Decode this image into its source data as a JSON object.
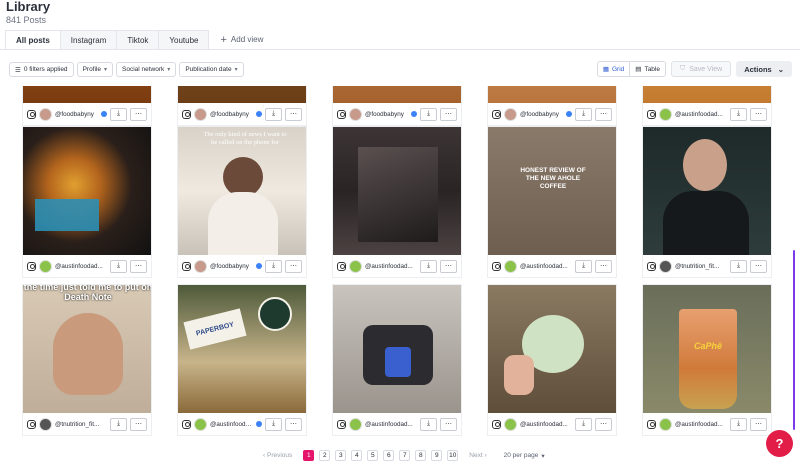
{
  "header": {
    "title": "Library",
    "subtitle": "841 Posts"
  },
  "tabs": [
    {
      "label": "All posts",
      "active": true
    },
    {
      "label": "Instagram",
      "active": false
    },
    {
      "label": "Tiktok",
      "active": false
    },
    {
      "label": "Youtube",
      "active": false
    }
  ],
  "add_view": "Add view",
  "filters": {
    "applied": "0 filters applied",
    "profile": "Profile",
    "social_network": "Social network",
    "publication_date": "Publication date"
  },
  "view_toggle": {
    "grid": "Grid",
    "table": "Table"
  },
  "save_view": "Save View",
  "actions": "Actions",
  "row_top": [
    {
      "handle": "@foodbabyny",
      "verified": true
    },
    {
      "handle": "@foodbabyny",
      "verified": true
    },
    {
      "handle": "@foodbabyny",
      "verified": true
    },
    {
      "handle": "@foodbabyny",
      "verified": true
    },
    {
      "handle": "@austinfoodad...",
      "verified": false
    }
  ],
  "row_1": [
    {
      "handle": "@austinfoodad...",
      "verified": false,
      "overlay": ""
    },
    {
      "handle": "@foodbabyny",
      "verified": true,
      "overlay": "The only kind of news I want to be called on the phone for"
    },
    {
      "handle": "@austinfoodad...",
      "verified": false,
      "overlay": ""
    },
    {
      "handle": "@austinfoodad...",
      "verified": false,
      "overlay": "HONEST REVIEW OF THE NEW AHOLE COFFEE"
    },
    {
      "handle": "@tnutrition_fit...",
      "verified": false,
      "overlay": ""
    }
  ],
  "row_2": [
    {
      "handle": "@tnutrition_fit...",
      "verified": false,
      "overlay": "the time just told me to put on Death Note"
    },
    {
      "handle": "@austinfoodad...",
      "verified": false,
      "overlay": "PAPERBOY"
    },
    {
      "handle": "@austinfoodad...",
      "verified": false,
      "overlay": ""
    },
    {
      "handle": "@austinfoodad...",
      "verified": false,
      "overlay": ""
    },
    {
      "handle": "@austinfoodad...",
      "verified": false,
      "overlay": "CaPhê"
    }
  ],
  "pagination": {
    "prev": "Previous",
    "next": "Next",
    "pages": [
      "1",
      "2",
      "3",
      "4",
      "5",
      "6",
      "7",
      "8",
      "9",
      "10"
    ],
    "current": "1",
    "per_page": "20 per page"
  },
  "colors": {
    "accent": "#e5156b",
    "link": "#2f5bd3",
    "scroll": "#7c3aed",
    "help": "#e11d48"
  }
}
